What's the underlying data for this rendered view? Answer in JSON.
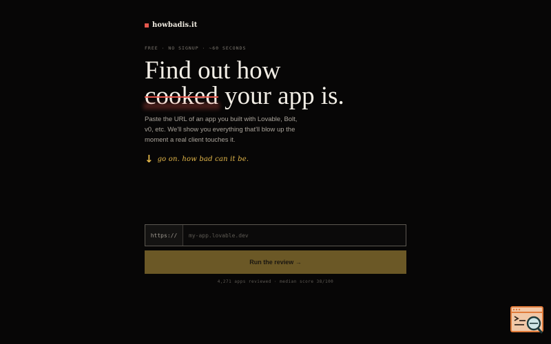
{
  "brand": {
    "name": "howbadis.it",
    "mark_color": "#e5574d"
  },
  "meta": {
    "text": "FREE · NO SIGNUP · ~60 SECONDS"
  },
  "hero": {
    "line1": "Find out how",
    "struck_word": "cooked",
    "line2_rest": " your app is."
  },
  "subtitle": "Paste the URL of an app you built with Lovable, Bolt, v0, etc. We'll show you everything that'll blow up the moment a real client touches it.",
  "tagline": {
    "arrow": "↓",
    "text": "go on. how bad can it be."
  },
  "url_form": {
    "prefix": "https://",
    "placeholder": "my-app.lovable.dev",
    "value": ""
  },
  "run_button": {
    "label": "Run the review →"
  },
  "stats": {
    "text": "4,271 apps reviewed · median score 38/100"
  },
  "corner_widget": {
    "icon": "terminal-search-icon"
  },
  "colors": {
    "background": "#070606",
    "accent_red": "#e5574d",
    "accent_gold": "#e6b94a",
    "button_bg": "#6b5826"
  }
}
